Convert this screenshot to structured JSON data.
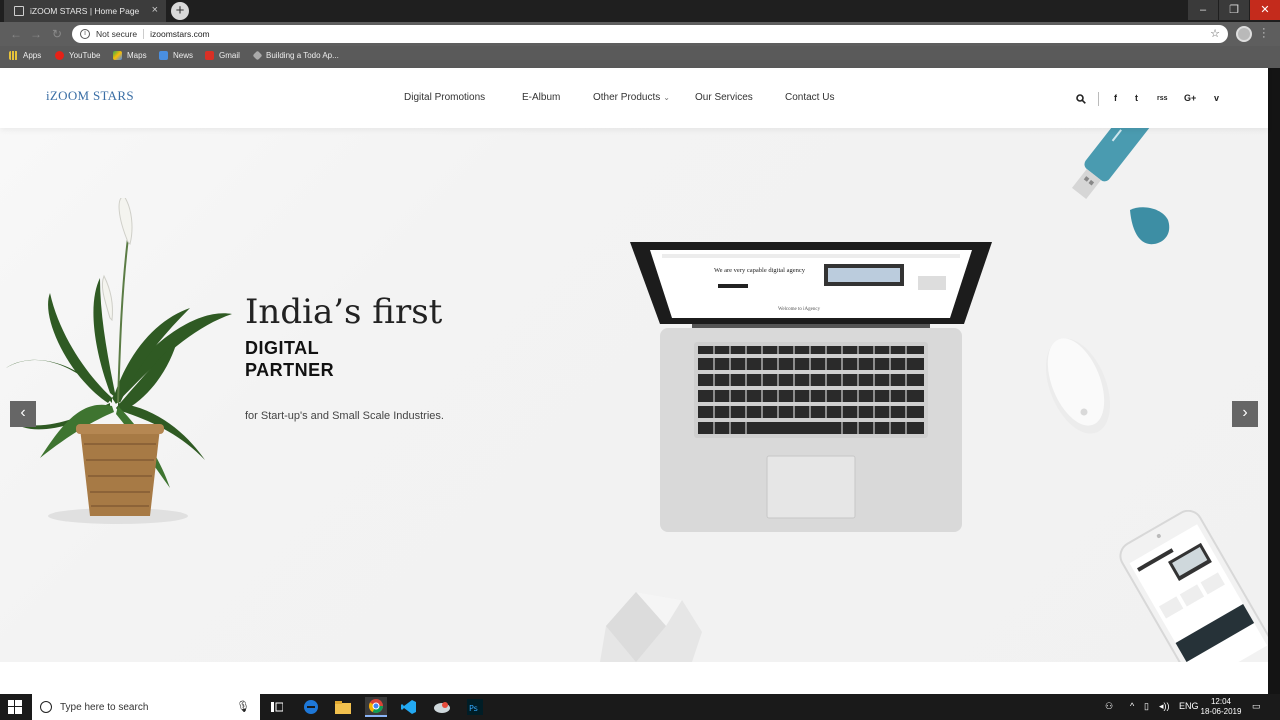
{
  "browser": {
    "tab_title": "iZOOM STARS | Home Page",
    "tab_close": "×",
    "new_tab": "+",
    "window_controls": [
      "–",
      "❐",
      "✕"
    ],
    "security_label": "Not secure",
    "url": "izoomstars.com",
    "bookmarks": [
      "Apps",
      "YouTube",
      "Maps",
      "News",
      "Gmail",
      "Building a Todo Ap..."
    ]
  },
  "site": {
    "brand": "iZOOM STARS",
    "menu": [
      "Digital Promotions",
      "E-Album",
      "Other Products",
      "Our Services",
      "Contact Us"
    ],
    "social": [
      "f",
      "t",
      "rss",
      "G+",
      "v"
    ]
  },
  "hero": {
    "title": "India’s first",
    "subtitle_line1": "DIGITAL",
    "subtitle_line2": "PARTNER",
    "tagline": "for Start-up's and Small Scale Industries.",
    "prev_arrow": "‹",
    "next_arrow": "›",
    "laptop_screen_heading": "We are very capable digital agency",
    "laptop_screen_footer": "Welcome to iAgency"
  },
  "taskbar": {
    "search_placeholder": "Type here to search",
    "language": "ENG",
    "time": "12:04",
    "date": "18-06-2019"
  },
  "colors": {
    "brand": "#3a6ea5",
    "hero_bg": "#f3f3f3",
    "teal_usb": "#4a9bb0"
  }
}
